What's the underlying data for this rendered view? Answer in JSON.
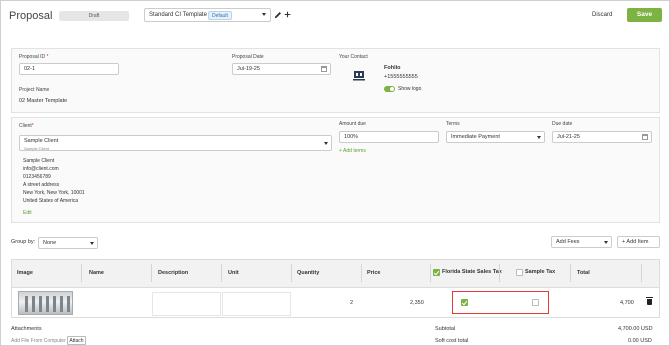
{
  "header": {
    "title": "Proposal",
    "status": "Draft",
    "template_label": "Standard CI Template",
    "template_badge": "Default",
    "discard_label": "Discard",
    "save_label": "Save",
    "save_color": "#7cb342"
  },
  "proposal": {
    "id_label": "Proposal ID",
    "id_value": "02-1",
    "date_label": "Proposal Date",
    "date_value": "Jul-19-25",
    "project_name_label": "Project Name",
    "project_name_value": "02 Master Template"
  },
  "contact": {
    "label": "Your Contact",
    "name": "Fohlio",
    "phone": "+1555555555",
    "show_logo_label": "Show logo",
    "show_logo_on": true
  },
  "client": {
    "label": "Client",
    "select_value": "Sample Client",
    "select_sub": "Sample Client",
    "address_lines": [
      "Sample Client",
      "info@client.com",
      "0123456789",
      "A street address",
      "New York, New York, 10001",
      "United States of America"
    ],
    "edit_label": "Edit"
  },
  "billing": {
    "amount_due_label": "Amount due",
    "amount_due_value": "100%",
    "add_terms_label": "+ Add terms",
    "terms_label": "Terms",
    "terms_value": "Immediate Payment",
    "due_date_label": "Due date",
    "due_date_value": "Jul-21-25"
  },
  "toolbar": {
    "group_by_label": "Group by:",
    "group_by_value": "None",
    "add_fees_label": "Add Fees",
    "add_item_label": "+ Add Item"
  },
  "table": {
    "columns": [
      "Image",
      "Name",
      "Description",
      "Unit",
      "Quantity",
      "Price",
      "Florida State Sales Tax",
      "Sample Tax",
      "Total"
    ],
    "tax_checks": {
      "florida_header": true,
      "sample_header": false
    },
    "rows": [
      {
        "name": "",
        "description": "",
        "unit": "",
        "quantity": "2",
        "price": "2,350",
        "florida_tax": true,
        "sample_tax": false,
        "total": "4,700"
      }
    ]
  },
  "footer": {
    "attachments_label": "Attachments",
    "add_file_label": "Add File From Computer",
    "attach_label": "Attach",
    "subtotal_label": "Subtotal",
    "subtotal_value": "4,700.00 USD",
    "soft_cost_label": "Soft cost total",
    "soft_cost_value": "0.00 USD"
  },
  "colors": {
    "accent_green": "#7cb342",
    "highlight_red": "#e53935"
  }
}
